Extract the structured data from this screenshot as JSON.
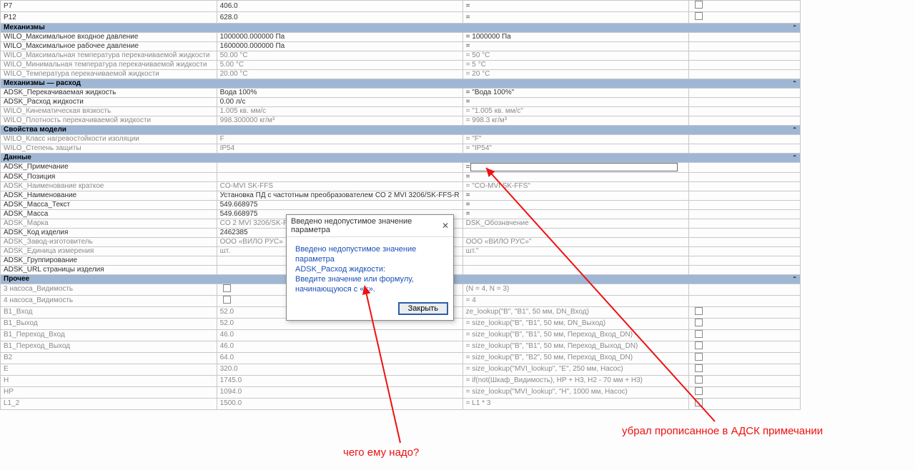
{
  "cats": {
    "top_rows": [
      {
        "n": "P7",
        "v": "406.0",
        "f": "=",
        "chk": true
      },
      {
        "n": "P12",
        "v": "628.0",
        "f": "=",
        "chk": true
      }
    ],
    "mechanisms": {
      "title": "Механизмы",
      "rows": [
        {
          "n": "WILO_Максимальное входное давление",
          "v": "1000000.000000 Па",
          "f": "= 1000000 Па",
          "dim": false,
          "chk": false
        },
        {
          "n": "WILO_Максимальное рабочее давление",
          "v": "1600000.000000 Па",
          "f": "=",
          "dim": false,
          "chk": false
        },
        {
          "n": "WILO_Максимальная температура перекачиваемой жидкости",
          "v": "50.00 °C",
          "f": "= 50 °C",
          "dim": true,
          "chk": false
        },
        {
          "n": "WILO_Минимальная температура перекачиваемой жидкости",
          "v": "5.00 °C",
          "f": "= 5 °C",
          "dim": true,
          "chk": false
        },
        {
          "n": "WILO_Температура перекачиваемой жидкости",
          "v": "20.00 °C",
          "f": "= 20 °C",
          "dim": true,
          "chk": false
        }
      ]
    },
    "mech_flow": {
      "title": "Механизмы — расход",
      "rows": [
        {
          "n": "ADSK_Перекачиваемая жидкость",
          "v": "Вода 100%",
          "f": "= \"Вода 100%\"",
          "dim": false,
          "chk": false
        },
        {
          "n": "ADSK_Расход жидкости",
          "v": "0.00 л/с",
          "f": "=",
          "dim": false,
          "chk": false
        },
        {
          "n": "WILO_Кинематическая вязкость",
          "v": "1.005 кв. мм/с",
          "f": "= \"1.005 кв. мм/с\"",
          "dim": true,
          "chk": false
        },
        {
          "n": "WILO_Плотность перекачиваемой жидкости",
          "v": "998.300000 кг/м³",
          "f": "= 998.3 кг/м³",
          "dim": true,
          "chk": false
        }
      ]
    },
    "model_props": {
      "title": "Свойства модели",
      "rows": [
        {
          "n": "WILO_Класс нагревостойкости изоляции",
          "v": "F",
          "f": "= \"F\"",
          "dim": true,
          "chk": false
        },
        {
          "n": "WILO_Степень защиты",
          "v": "IP54",
          "f": "= \"IP54\"",
          "dim": true,
          "chk": false
        }
      ]
    },
    "data": {
      "title": "Данные",
      "rows": [
        {
          "n": "ADSK_Примечание",
          "v": "",
          "f": "=",
          "edit": true,
          "dim": false,
          "chk": false
        },
        {
          "n": "ADSK_Позиция",
          "v": "",
          "f": "=",
          "dim": false,
          "chk": false
        },
        {
          "n": "ADSK_Наименование краткое",
          "v": "CO-MVI SK-FFS",
          "f": "= \"CO-MVI SK-FFS\"",
          "dim": true,
          "chk": false
        },
        {
          "n": "ADSK_Наименование",
          "v": "Установка ПД с частотным преобразователем CO 2 MVI 3206/SK-FFS-R",
          "f": "=",
          "dim": false,
          "chk": false
        },
        {
          "n": "ADSK_Масса_Текст",
          "v": "549.668975",
          "f": "=",
          "dim": false,
          "chk": false
        },
        {
          "n": "ADSK_Масса",
          "v": "549.668975",
          "f": "=",
          "dim": false,
          "chk": false
        },
        {
          "n": "ADSK_Марка",
          "v": "CO 2 MVI 3206/SK-FFS",
          "f": "DSK_Обозначение",
          "dim": true,
          "chk": false
        },
        {
          "n": "ADSK_Код изделия",
          "v": "2462385",
          "f": "",
          "dim": false,
          "chk": false
        },
        {
          "n": "ADSK_Завод-изготовитель",
          "v": "ООО «ВИЛО РУС»",
          "f": "ООО «ВИЛО РУС»\"",
          "dim": true,
          "chk": false
        },
        {
          "n": "ADSK_Единица измерения",
          "v": "шт.",
          "f": "шт.\"",
          "dim": true,
          "chk": false
        },
        {
          "n": "ADSK_Группирование",
          "v": "",
          "f": "",
          "dim": false,
          "chk": false
        },
        {
          "n": "ADSK_URL страницы изделия",
          "v": "",
          "f": "",
          "dim": false,
          "chk": false
        }
      ]
    },
    "other": {
      "title": "Прочее",
      "rows": [
        {
          "n": "3 насоса_Видимость",
          "v": "",
          "f": "(N = 4, N = 3)",
          "dim": true,
          "chk": false,
          "chkcell": true
        },
        {
          "n": "4 насоса_Видимость",
          "v": "",
          "f": "= 4",
          "dim": true,
          "chk": false,
          "chkcell": true
        },
        {
          "n": "B1_Вход",
          "v": "52.0",
          "f": "ze_lookup(\"B\", \"B1\", 50 мм, DN_Вход)",
          "dim": true,
          "chk": true
        },
        {
          "n": "B1_Выход",
          "v": "52.0",
          "f": "= size_lookup(\"B\", \"B1\", 50 мм, DN_Выход)",
          "dim": true,
          "chk": true
        },
        {
          "n": "B1_Переход_Вход",
          "v": "46.0",
          "f": "= size_lookup(\"B\", \"B1\", 50 мм, Переход_Вход_DN)",
          "dim": true,
          "chk": true
        },
        {
          "n": "B1_Переход_Выход",
          "v": "46.0",
          "f": "= size_lookup(\"B\", \"B1\", 50 мм, Переход_Выход_DN)",
          "dim": true,
          "chk": true
        },
        {
          "n": "B2",
          "v": "64.0",
          "f": "= size_lookup(\"B\", \"B2\", 50 мм, Переход_Вход_DN)",
          "dim": true,
          "chk": true
        },
        {
          "n": "E",
          "v": "320.0",
          "f": "= size_lookup(\"MVI_lookup\", \"E\", 250 мм, Насос)",
          "dim": true,
          "chk": true
        },
        {
          "n": "H",
          "v": "1745.0",
          "f": "= if(not(Шкаф_Видимость), HP + H3, H2 - 70 мм + H3)",
          "dim": true,
          "chk": true
        },
        {
          "n": "HP",
          "v": "1094.0",
          "f": "= size_lookup(\"MVI_lookup\", \"H\", 1000 мм, Насос)",
          "dim": true,
          "chk": true
        },
        {
          "n": "L1_2",
          "v": "1500.0",
          "f": "= L1 * 3",
          "dim": true,
          "chk": true
        }
      ]
    }
  },
  "dialog": {
    "title": "Введено недопустимое значение параметра",
    "line1": "Введено недопустимое значение параметра",
    "line2": "ADSK_Расход жидкости:",
    "line3": "Введите значение или формулу,",
    "line4": "начинающуюся с «=».",
    "close": "Закрыть"
  },
  "annotations": {
    "a1": "чего ему надо?",
    "a2": "убрал прописанное в АДСК примечании"
  }
}
